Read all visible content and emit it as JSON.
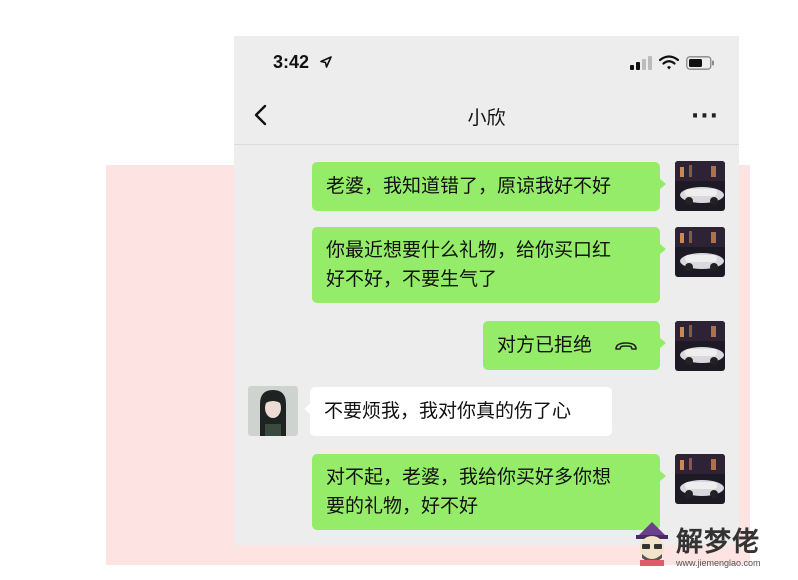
{
  "status_bar": {
    "time": "3:42",
    "location_icon": "location-arrow-icon",
    "signal_icon": "cellular-signal-icon",
    "wifi_icon": "wifi-icon",
    "battery_icon": "battery-icon"
  },
  "nav": {
    "back_icon": "chevron-left-icon",
    "title": "小欣",
    "more_label": "···"
  },
  "messages": [
    {
      "side": "me",
      "text": "老婆，我知道错了，原谅我好不好"
    },
    {
      "side": "me",
      "lines": [
        "你最近想要什么礼物，给你买口红",
        "好不好，不要生气了"
      ]
    },
    {
      "side": "me",
      "type": "call",
      "text": "对方已拒绝",
      "icon": "phone-hangup-icon"
    },
    {
      "side": "other",
      "text": "不要烦我，我对你真的伤了心"
    },
    {
      "side": "me",
      "lines": [
        "对不起，老婆，我给你买好多你想",
        "要的礼物，好不好"
      ]
    }
  ],
  "colors": {
    "my_bubble": "#95ec69",
    "their_bubble": "#ffffff",
    "chat_bg": "#ededed",
    "backdrop": "#fde3e1"
  },
  "watermark": {
    "name": "解梦佬",
    "url": "www.jiemenglao.com",
    "logo_icon": "mascot-logo-icon"
  }
}
